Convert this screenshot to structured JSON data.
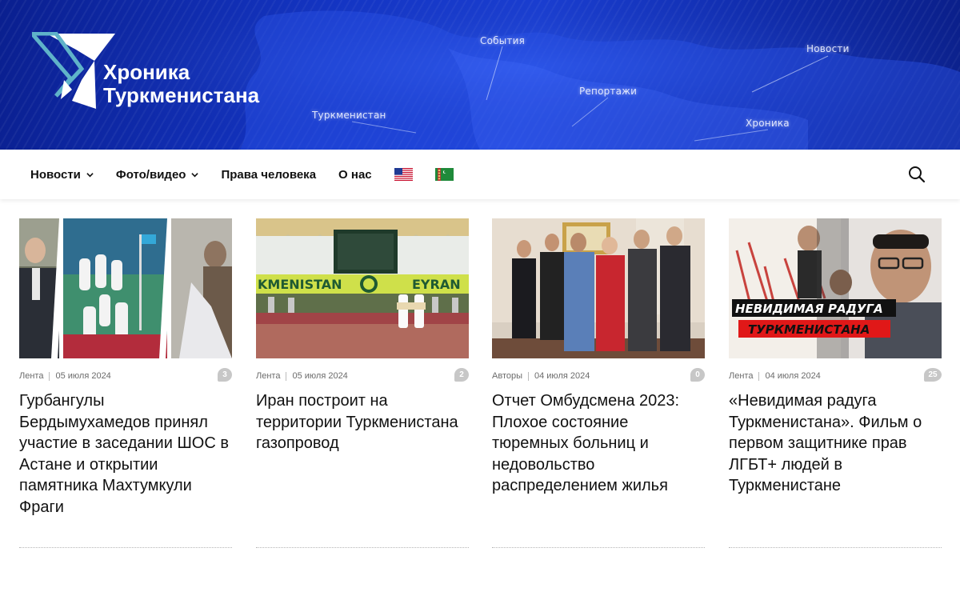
{
  "site": {
    "logo_line1": "Хроника",
    "logo_line2": "Туркменистана"
  },
  "banner": {
    "labels": [
      "События",
      "Новости",
      "Репортажи",
      "Туркменистан",
      "Хроника"
    ],
    "colors": {
      "dark": "#0a1f8f",
      "mid": "#1a3fd6"
    }
  },
  "nav": {
    "items": [
      {
        "label": "Новости",
        "dropdown": true
      },
      {
        "label": "Фото/видео",
        "dropdown": true
      },
      {
        "label": "Права человека",
        "dropdown": false
      },
      {
        "label": "О нас",
        "dropdown": false
      }
    ],
    "flags": [
      "us-flag-icon",
      "turkmenistan-flag-icon"
    ],
    "search_icon": "search-icon"
  },
  "articles": [
    {
      "category": "Лента",
      "date": "05 июля 2024",
      "comments": "3",
      "title": "Гурбангулы Бердымухамедов принял участие в заседании ШОС в Астане и открытии памятника Махтумкули Фраги"
    },
    {
      "category": "Лента",
      "date": "05 июля 2024",
      "comments": "2",
      "title": "Иран построит на территории Туркменистана газопровод",
      "image_text_left": "KMENISTAN",
      "image_text_right": "EYRAN"
    },
    {
      "category": "Авторы",
      "date": "04 июля 2024",
      "comments": "0",
      "title": "Отчет Омбудсмена 2023: Плохое состояние тюремных больниц и недовольство распределением жилья"
    },
    {
      "category": "Лента",
      "date": "04 июля 2024",
      "comments": "25",
      "title": "«Невидимая радуга Туркменистана». Фильм о первом защитнике прав ЛГБТ+ людей в Туркменистане",
      "image_caption_1": "НЕВИДИМАЯ РАДУГА",
      "image_caption_2": "ТУРКМЕНИСТАНА"
    }
  ]
}
